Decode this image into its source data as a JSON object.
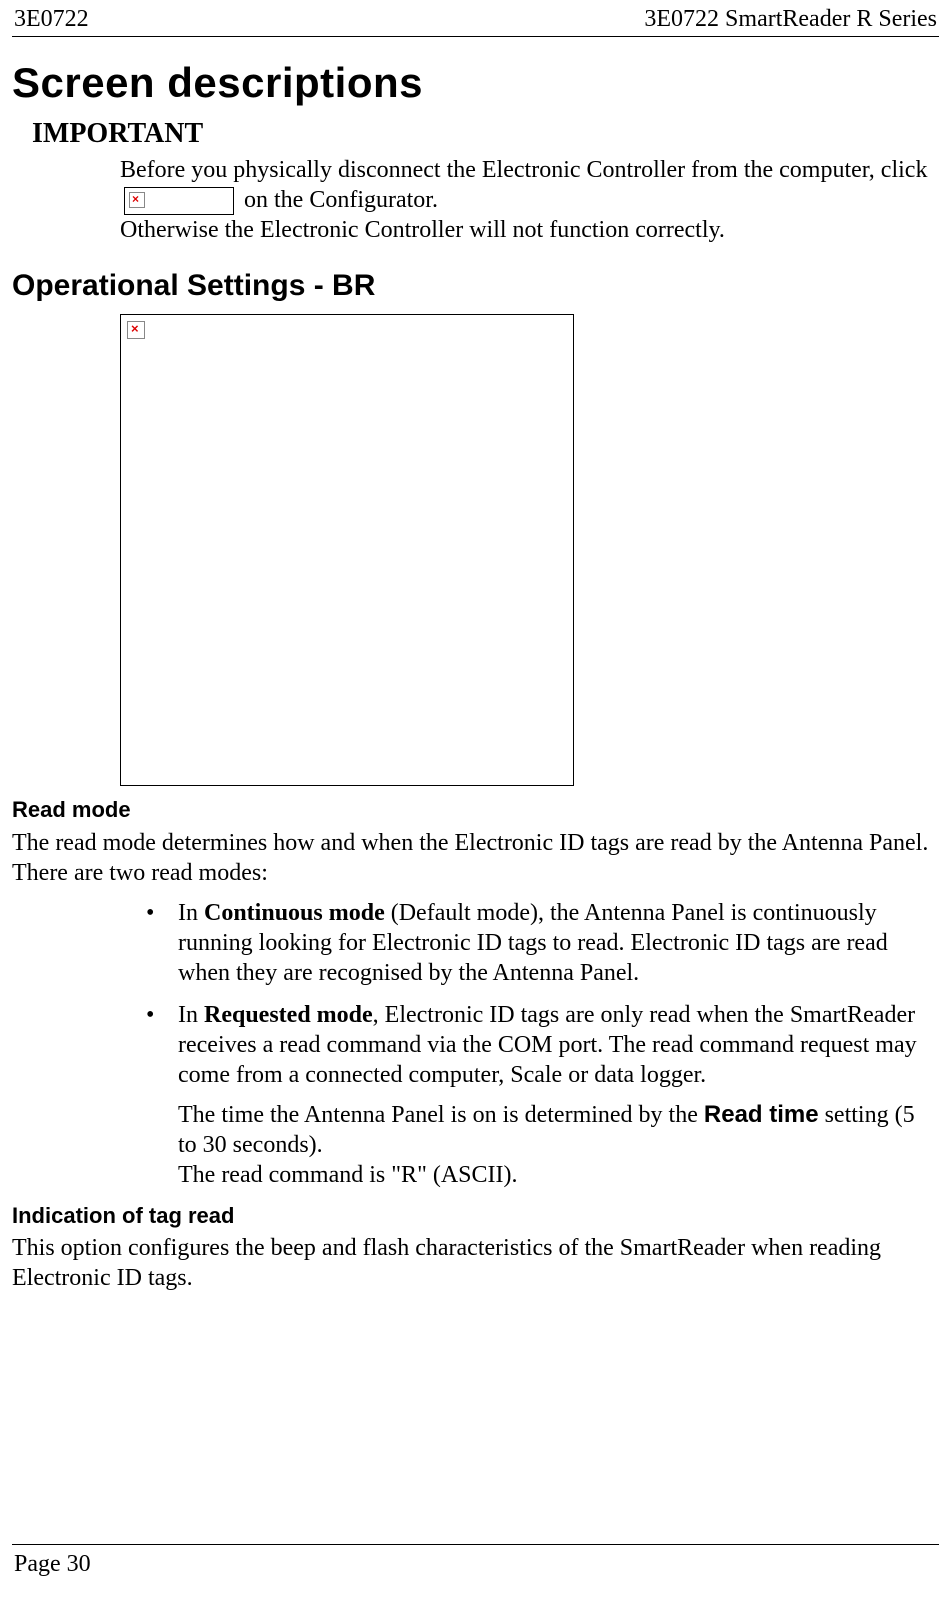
{
  "header": {
    "left": "3E0722",
    "right": "3E0722 SmartReader R Series"
  },
  "title": "Screen descriptions",
  "important": {
    "label": "IMPORTANT",
    "line1a": "Before you physically disconnect the Electronic Controller from the computer, click ",
    "line1b": " on the Configurator.",
    "line2": "Otherwise the Electronic Controller will not function correctly."
  },
  "section1": {
    "heading": "Operational Settings - BR"
  },
  "readmode": {
    "heading": "Read mode",
    "intro": "The read mode determines how and when the Electronic ID tags are read by the Antenna Panel.  There are two read modes:",
    "b1_pre": "In ",
    "b1_bold": "Continuous mode",
    "b1_post": " (Default mode), the Antenna Panel is continuously running looking for Electronic ID tags to read.  Electronic ID tags are read when they are recognised by the Antenna Panel.",
    "b2_pre": "In ",
    "b2_bold": "Requested mode",
    "b2_post": ", Electronic ID tags are only read when the SmartReader receives a read command via the COM port.  The read command request may come from a connected computer, Scale or data logger.",
    "b2_sub1_pre": "The time the Antenna Panel is on is determined by the ",
    "b2_sub1_bold": "Read time",
    "b2_sub1_post": " setting (5 to 30 seconds).",
    "b2_sub2": "The read command is \"R\" (ASCII)."
  },
  "indication": {
    "heading": "Indication of tag read",
    "para": "This option configures the beep and flash characteristics of the SmartReader when reading Electronic ID tags."
  },
  "footer": {
    "page": "Page 30"
  }
}
